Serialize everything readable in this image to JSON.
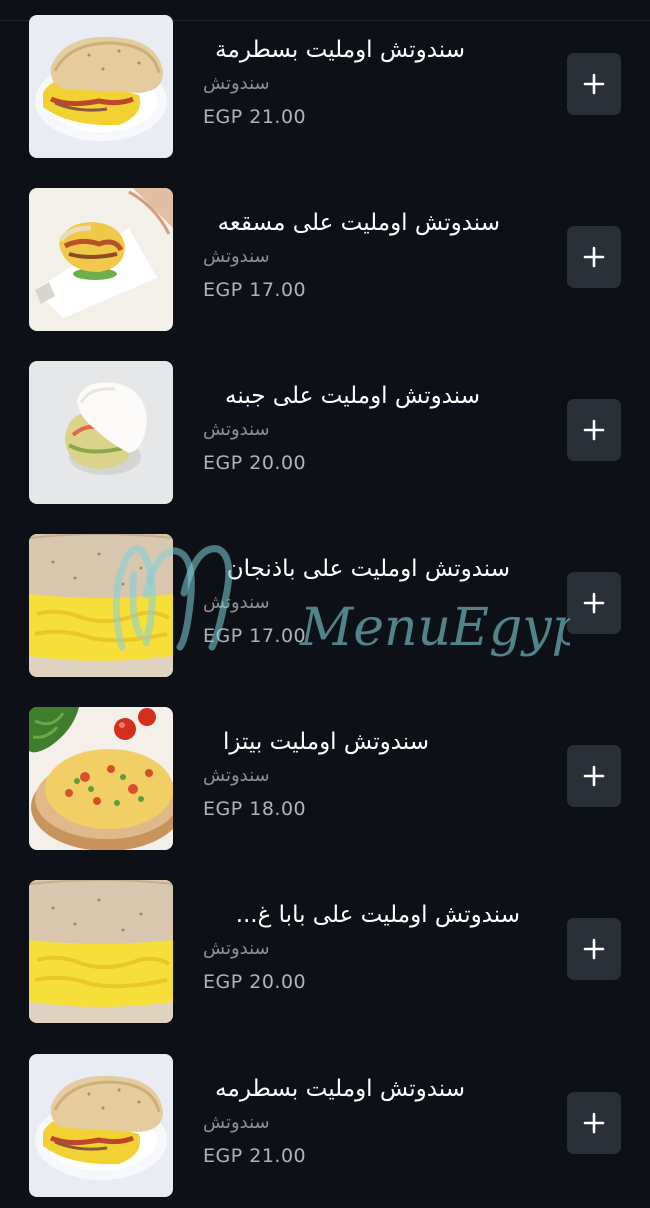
{
  "currency": "EGP",
  "watermark": "MenuEgypt.com",
  "colors": {
    "background": "#0d1117",
    "button_bg": "#2a3038",
    "category_text": "#8a9097",
    "price_text": "#aeb4ba",
    "watermark": "#7fd0d8"
  },
  "items": [
    {
      "title": "سندوتش اومليت بسطرمة",
      "category": "سندوتش",
      "price": "EGP 21.00",
      "icon": "plus-icon",
      "image": "pita-omelette-pastrami"
    },
    {
      "title": "سندوتش اومليت على مسقعه",
      "category": "سندوتش",
      "price": "EGP 17.00",
      "icon": "plus-icon",
      "image": "pita-omelette-moussaka"
    },
    {
      "title": "سندوتش اومليت على جبنه",
      "category": "سندوتش",
      "price": "EGP 20.00",
      "icon": "plus-icon",
      "image": "pita-omelette-cheese"
    },
    {
      "title": "سندوتش اومليت على باذنجان",
      "category": "سندوتش",
      "price": "EGP 17.00",
      "icon": "plus-icon",
      "image": "bread-omelette-eggplant"
    },
    {
      "title": "سندوتش اومليت بيتزا",
      "category": "سندوتش",
      "price": "EGP 18.00",
      "icon": "plus-icon",
      "image": "omelette-pizza"
    },
    {
      "title": "سندوتش اومليت على بابا غ...",
      "category": "سندوتش",
      "price": "EGP 20.00",
      "icon": "plus-icon",
      "image": "bread-omelette-babaghanoug"
    },
    {
      "title": "سندوتش اومليت بسطرمه",
      "category": "سندوتش",
      "price": "EGP 21.00",
      "icon": "plus-icon",
      "image": "pita-omelette-pastrami"
    }
  ]
}
